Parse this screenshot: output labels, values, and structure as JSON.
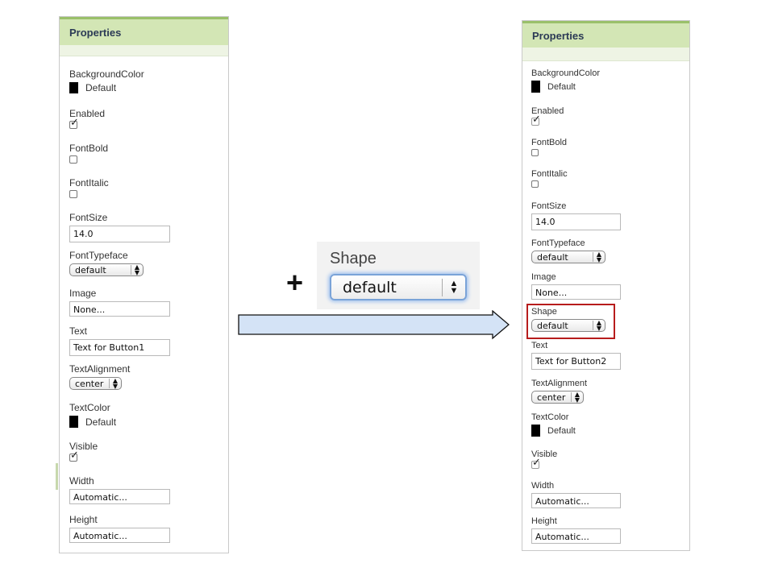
{
  "left_panel": {
    "title": "Properties",
    "properties": {
      "background_color": {
        "label": "BackgroundColor",
        "value": "Default"
      },
      "enabled": {
        "label": "Enabled",
        "checked": true
      },
      "font_bold": {
        "label": "FontBold",
        "checked": false
      },
      "font_italic": {
        "label": "FontItalic",
        "checked": false
      },
      "font_size": {
        "label": "FontSize",
        "value": "14.0"
      },
      "font_typeface": {
        "label": "FontTypeface",
        "value": "default"
      },
      "image": {
        "label": "Image",
        "value": "None..."
      },
      "text": {
        "label": "Text",
        "value": "Text for Button1"
      },
      "text_alignment": {
        "label": "TextAlignment",
        "value": "center"
      },
      "text_color": {
        "label": "TextColor",
        "value": "Default"
      },
      "visible": {
        "label": "Visible",
        "checked": true
      },
      "width": {
        "label": "Width",
        "value": "Automatic..."
      },
      "height": {
        "label": "Height",
        "value": "Automatic..."
      }
    }
  },
  "callout": {
    "plus": "+",
    "label": "Shape",
    "value": "default",
    "arrow_icon": "up-down-arrows"
  },
  "right_panel": {
    "title": "Properties",
    "properties": {
      "background_color": {
        "label": "BackgroundColor",
        "value": "Default"
      },
      "enabled": {
        "label": "Enabled",
        "checked": true
      },
      "font_bold": {
        "label": "FontBold",
        "checked": false
      },
      "font_italic": {
        "label": "FontItalic",
        "checked": false
      },
      "font_size": {
        "label": "FontSize",
        "value": "14.0"
      },
      "font_typeface": {
        "label": "FontTypeface",
        "value": "default"
      },
      "image": {
        "label": "Image",
        "value": "None..."
      },
      "shape": {
        "label": "Shape",
        "value": "default"
      },
      "text": {
        "label": "Text",
        "value": "Text for Button2"
      },
      "text_alignment": {
        "label": "TextAlignment",
        "value": "center"
      },
      "text_color": {
        "label": "TextColor",
        "value": "Default"
      },
      "visible": {
        "label": "Visible",
        "checked": true
      },
      "width": {
        "label": "Width",
        "value": "Automatic..."
      },
      "height": {
        "label": "Height",
        "value": "Automatic..."
      }
    }
  },
  "colors": {
    "header_bg": "#d3e6b5",
    "header_border": "#9ac06a",
    "arrow_fill": "#d4e3f6",
    "highlight": "#b71c1c",
    "focus_glow": "#a9c7ef"
  }
}
